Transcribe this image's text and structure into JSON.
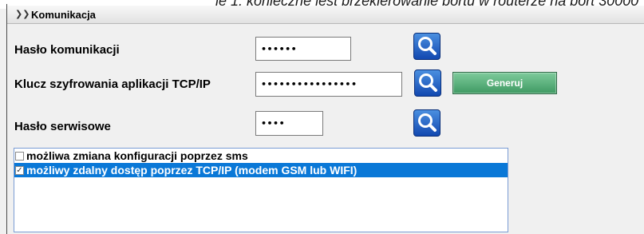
{
  "top_text": "ie 1: konieczne jest przekierowanie portu w routerze na port 30000",
  "section": {
    "title": "Komunikacja",
    "icon": "collapse-double-chevron"
  },
  "fields": {
    "comm_password": {
      "label": "Hasło komunikacji",
      "value": "••••••"
    },
    "tcp_key": {
      "label": "Klucz szyfrowania aplikacji TCP/IP",
      "value": "••••••••••••••••"
    },
    "service_password": {
      "label": "Hasło serwisowe",
      "value": "••••"
    }
  },
  "buttons": {
    "generate_label": "Generuj"
  },
  "options": [
    {
      "label": "możliwa zmiana konfiguracji poprzez sms",
      "checked": false,
      "selected": false
    },
    {
      "label": "możliwy zdalny dostęp poprzez TCP/IP (modem GSM lub WIFI)",
      "checked": true,
      "selected": true
    }
  ],
  "colors": {
    "selection": "#0a78d7",
    "search_button": "#1f5fc8",
    "generate_button": "#5db47f"
  }
}
